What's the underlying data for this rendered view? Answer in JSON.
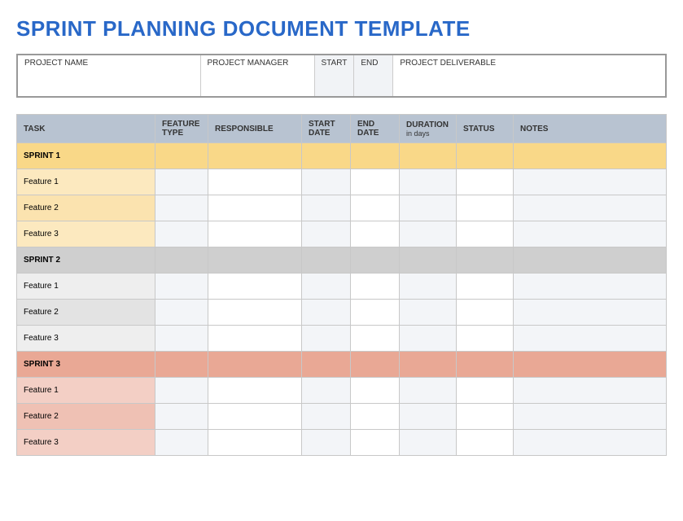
{
  "title": "SPRINT PLANNING DOCUMENT TEMPLATE",
  "meta": {
    "headers": {
      "project_name": "PROJECT NAME",
      "project_manager": "PROJECT MANAGER",
      "start": "START",
      "end": "END",
      "deliverable": "PROJECT DELIVERABLE"
    },
    "values": {
      "project_name": "",
      "project_manager": "",
      "start": "",
      "end": "",
      "deliverable": ""
    }
  },
  "columns": {
    "task": "TASK",
    "feature_type": "FEATURE TYPE",
    "responsible": "RESPONSIBLE",
    "start_date": "START DATE",
    "end_date": "END DATE",
    "duration": "DURATION",
    "duration_sub": "in days",
    "status": "STATUS",
    "notes": "NOTES"
  },
  "rows": [
    {
      "class": "sprint-1",
      "task": "SPRINT 1"
    },
    {
      "class": "feat-1-odd",
      "task": "Feature 1"
    },
    {
      "class": "feat-1-even",
      "task": "Feature 2"
    },
    {
      "class": "feat-1-odd",
      "task": "Feature 3"
    },
    {
      "class": "sprint-2",
      "task": "SPRINT 2"
    },
    {
      "class": "feat-2-odd",
      "task": "Feature 1"
    },
    {
      "class": "feat-2-even",
      "task": "Feature 2"
    },
    {
      "class": "feat-2-odd",
      "task": "Feature 3"
    },
    {
      "class": "sprint-3",
      "task": "SPRINT 3"
    },
    {
      "class": "feat-3-odd",
      "task": "Feature 1"
    },
    {
      "class": "feat-3-even",
      "task": "Feature 2"
    },
    {
      "class": "feat-3-odd",
      "task": "Feature 3"
    }
  ]
}
